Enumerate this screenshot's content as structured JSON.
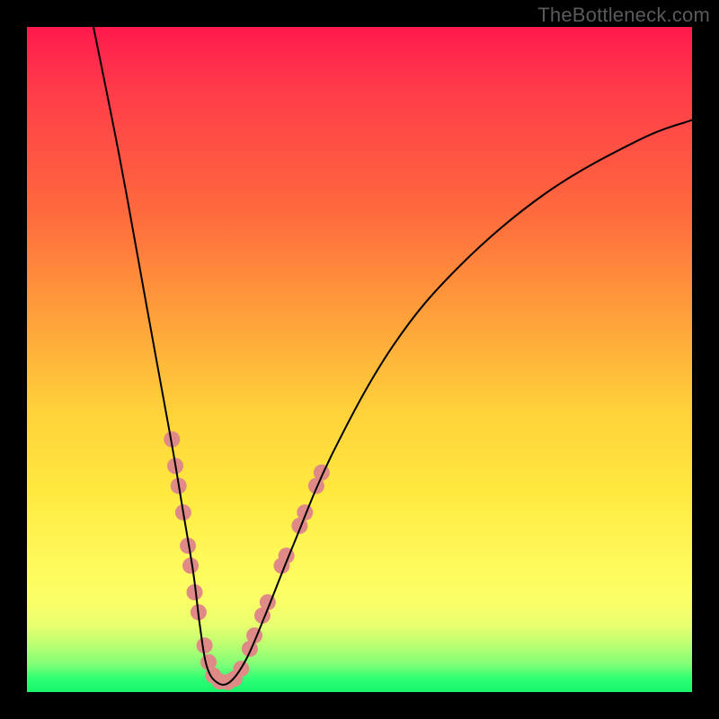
{
  "watermark": "TheBottleneck.com",
  "chart_data": {
    "type": "line",
    "title": "",
    "xlabel": "",
    "ylabel": "",
    "xlim": [
      0,
      100
    ],
    "ylim": [
      0,
      100
    ],
    "legend": null,
    "annotations": [],
    "series": [
      {
        "name": "bottleneck-curve",
        "x": [
          10,
          14,
          18,
          20,
          22,
          23.5,
          25,
          26,
          27,
          28.5,
          30.5,
          33,
          36,
          40,
          46,
          55,
          65,
          78,
          92,
          100
        ],
        "values": [
          100,
          80,
          58,
          47,
          36,
          27,
          18,
          10,
          4,
          1.5,
          1.5,
          5,
          12,
          22,
          36,
          52,
          64,
          75,
          83,
          86
        ],
        "stroke": "#000000",
        "stroke_width": 2
      }
    ],
    "markers": [
      {
        "name": "highlight-dots-left",
        "color": "#e08a87",
        "radius": 9,
        "points_xy": [
          [
            21.8,
            38
          ],
          [
            22.3,
            34
          ],
          [
            22.8,
            31
          ],
          [
            23.5,
            27
          ],
          [
            24.2,
            22
          ],
          [
            24.6,
            19
          ],
          [
            25.2,
            15
          ],
          [
            25.8,
            12
          ],
          [
            26.7,
            7
          ],
          [
            27.3,
            4.5
          ],
          [
            28.0,
            2.5
          ],
          [
            29.0,
            1.6
          ],
          [
            30.2,
            1.5
          ]
        ]
      },
      {
        "name": "highlight-dots-right",
        "color": "#e08a87",
        "radius": 9,
        "points_xy": [
          [
            31.2,
            2.0
          ],
          [
            32.2,
            3.5
          ],
          [
            33.5,
            6.5
          ],
          [
            34.2,
            8.5
          ],
          [
            35.4,
            11.5
          ],
          [
            36.2,
            13.5
          ],
          [
            38.3,
            19
          ],
          [
            39.0,
            20.5
          ],
          [
            41.0,
            25
          ],
          [
            41.8,
            27
          ],
          [
            43.5,
            31
          ],
          [
            44.3,
            33
          ]
        ]
      }
    ],
    "background_gradient": {
      "top": "#ff1a4d",
      "mid1": "#ffa23a",
      "mid2": "#fff95a",
      "bottom": "#18f56a"
    }
  }
}
